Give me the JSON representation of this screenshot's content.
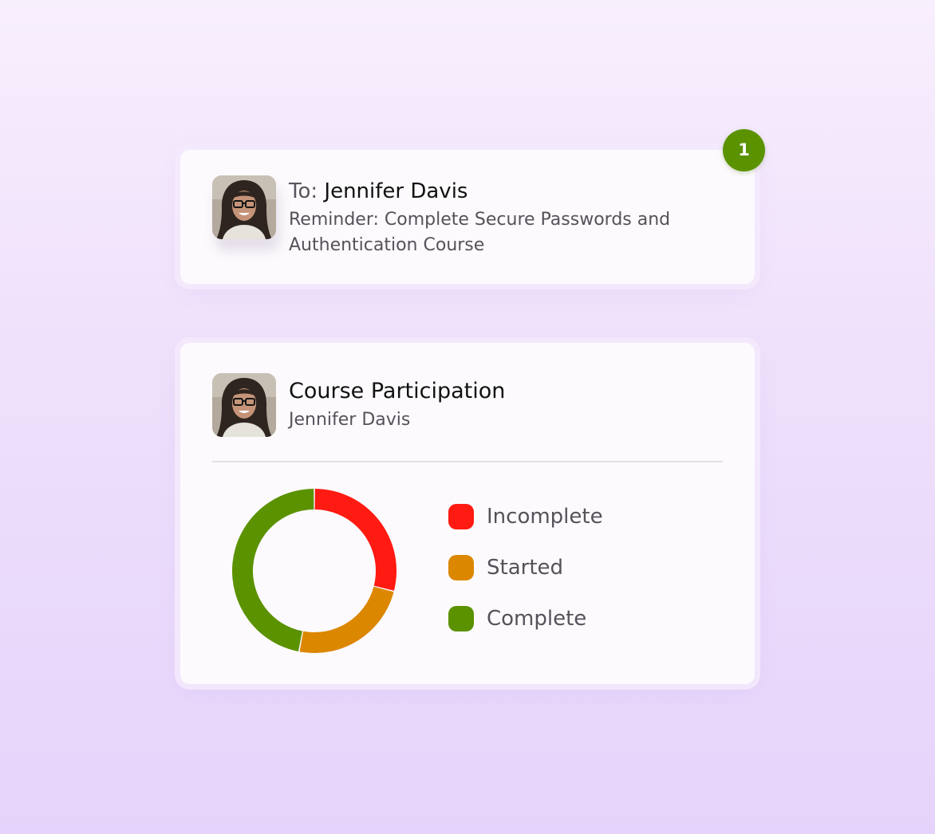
{
  "reminder_card": {
    "to_prefix": "To: ",
    "recipient": "Jennifer Davis",
    "subject": "Reminder: Complete Secure Passwords and Authentication Course",
    "badge_count": "1",
    "avatar_icon": "person-avatar"
  },
  "participation_card": {
    "title": "Course Participation",
    "subtitle": "Jennifer Davis",
    "avatar_icon": "person-avatar"
  },
  "chart_data": {
    "type": "pie",
    "donut": true,
    "categories": [
      "Incomplete",
      "Started",
      "Complete"
    ],
    "values": [
      29,
      24,
      47
    ],
    "colors": [
      "#ff1a12",
      "#dc8700",
      "#5b9200"
    ],
    "legend_position": "right"
  }
}
